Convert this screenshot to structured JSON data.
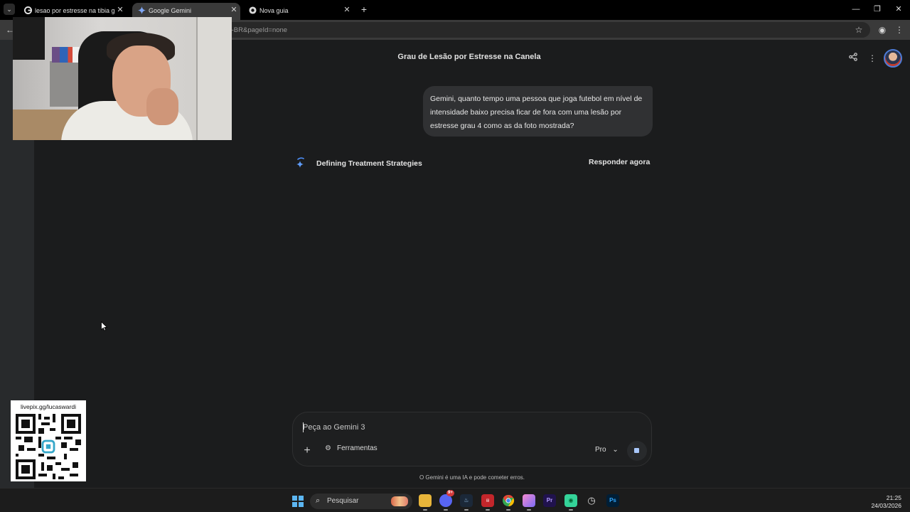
{
  "browser": {
    "tabs": [
      {
        "title": "lesao por estresse na tibia grau",
        "favicon": "google-g-icon",
        "active": false
      },
      {
        "title": "Google Gemini",
        "favicon": "gemini-spark-icon",
        "active": true
      },
      {
        "title": "Nova guia",
        "favicon": "chrome-icon",
        "active": false
      }
    ],
    "new_tab_label": "+",
    "address_text": "t-BR&pageId=none",
    "window_controls": [
      "minimize-icon",
      "restore-icon",
      "close-icon"
    ]
  },
  "gemini": {
    "conversation_title": "Grau de Lesão por Estresse na Canela",
    "user_message": "Gemini, quanto tempo uma pessoa que joga futebol em nível de intensidade baixo precisa ficar de fora com uma lesão por estresse grau 4 como as da foto mostrada?",
    "thinking_label": "Defining Treatment Strategies",
    "respond_now_label": "Responder agora",
    "input_placeholder": "Peça ao Gemini 3",
    "tools_label": "Ferramentas",
    "model_label": "Pro",
    "disclaimer": "O Gemini é uma IA e pode cometer erros.",
    "accent_color": "#a8c7fa"
  },
  "overlay": {
    "donation_url": "livepix.gg/lucaswardi"
  },
  "taskbar": {
    "search_label": "Pesquisar",
    "apps": [
      "file-explorer-icon",
      "discord-icon",
      "steam-icon",
      "news-app-icon",
      "chrome-icon",
      "photos-icon",
      "premiere-icon",
      "android-icon",
      "clock-app-icon",
      "photoshop-icon"
    ],
    "discord_badge": "9+",
    "time": "21:25",
    "date": "24/03/2026"
  }
}
